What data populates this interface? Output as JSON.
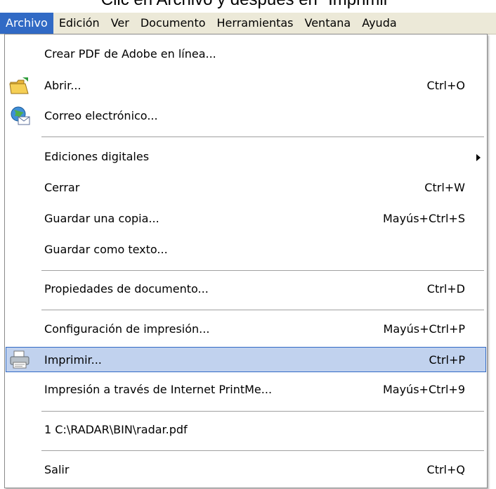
{
  "caption": "Clic en Archivo y después en \"Imprimir\"",
  "menubar": {
    "items": [
      "Archivo",
      "Edición",
      "Ver",
      "Documento",
      "Herramientas",
      "Ventana",
      "Ayuda"
    ],
    "active": "Archivo"
  },
  "menu": {
    "items": [
      {
        "label": "Crear PDF de Adobe en línea...",
        "shortcut": ""
      },
      {
        "label": "Abrir...",
        "shortcut": "Ctrl+O",
        "icon": "open-folder-icon"
      },
      {
        "label": "Correo electrónico...",
        "shortcut": "",
        "icon": "email-globe-icon"
      },
      {
        "label": "Ediciones digitales",
        "shortcut": "",
        "submenu": true
      },
      {
        "label": "Cerrar",
        "shortcut": "Ctrl+W"
      },
      {
        "label": "Guardar una copia...",
        "shortcut": "Mayús+Ctrl+S"
      },
      {
        "label": "Guardar como texto...",
        "shortcut": ""
      },
      {
        "label": "Propiedades de documento...",
        "shortcut": "Ctrl+D"
      },
      {
        "label": "Configuración de impresión...",
        "shortcut": "Mayús+Ctrl+P"
      },
      {
        "label": "Imprimir...",
        "shortcut": "Ctrl+P",
        "icon": "printer-icon",
        "highlighted": true
      },
      {
        "label": "Impresión a través de Internet PrintMe...",
        "shortcut": "Mayús+Ctrl+9"
      },
      {
        "label": "1 C:\\RADAR\\BIN\\radar.pdf",
        "shortcut": ""
      },
      {
        "label": "Salir",
        "shortcut": "Ctrl+Q"
      }
    ]
  },
  "colors": {
    "highlight_bg": "#c1d2ee",
    "highlight_border": "#316ac5",
    "menubar_bg": "#ece9d8",
    "active_menu_bg": "#316ac5"
  }
}
